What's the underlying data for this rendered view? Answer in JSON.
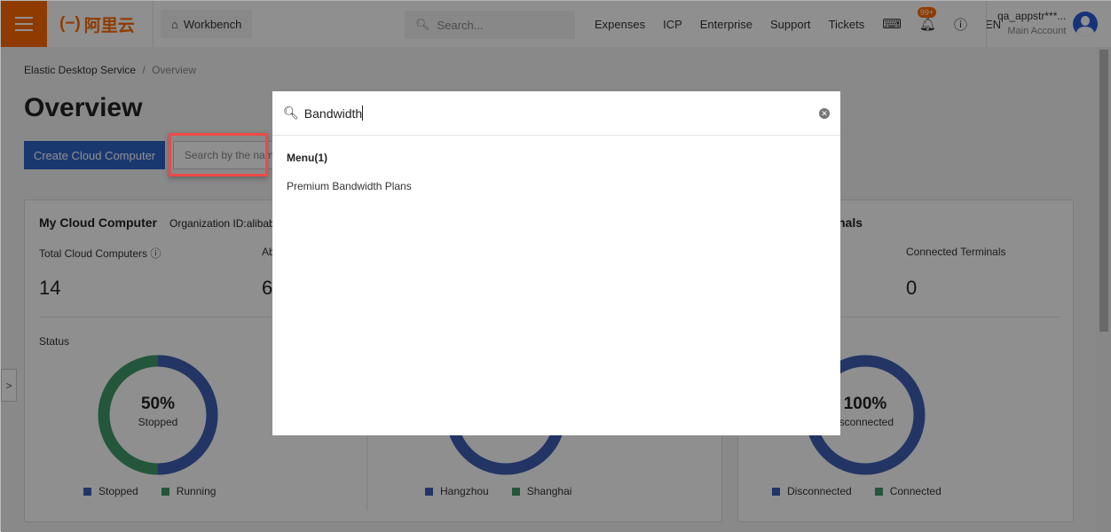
{
  "header": {
    "logo_text": "阿里云",
    "workbench": "Workbench",
    "search_placeholder": "Search...",
    "nav": [
      "Expenses",
      "ICP",
      "Enterprise",
      "Support",
      "Tickets"
    ],
    "notification_badge": "99+",
    "language": "EN",
    "account_name": "qa_appstr***...",
    "account_type": "Main Account",
    "brand_color": "#ff6a00"
  },
  "breadcrumb": {
    "parent": "Elastic Desktop Service",
    "sep": "/",
    "current": "Overview"
  },
  "page": {
    "title": "Overview",
    "create_button": "Create Cloud Computer",
    "search_placeholder": "Search by the name"
  },
  "card1": {
    "title": "My Cloud Computer",
    "org": "Organization ID:alibab",
    "total_label": "Total Cloud Computers",
    "total_value": "14",
    "second_label": "Ab",
    "second_value": "6",
    "status_label": "Status",
    "donut": {
      "percent": "50%",
      "caption": "Stopped",
      "stopped_fraction": 0.5,
      "legend": [
        "Stopped",
        "Running"
      ]
    },
    "region_donut": {
      "legend": [
        "Hangzhou",
        "Shanghai"
      ]
    }
  },
  "card2": {
    "title_partial": "nals",
    "connected_label": "Connected Terminals",
    "connected_value": "0",
    "donut": {
      "percent": "100%",
      "caption": "isconnected",
      "disconnected_fraction": 1.0,
      "legend": [
        "Disconnected",
        "Connected"
      ]
    }
  },
  "colors": {
    "blue": "#3d5fb5",
    "green": "#3f9a68"
  },
  "modal": {
    "query": "Bandwidth",
    "group": "Menu(1)",
    "results": [
      "Premium Bandwidth Plans"
    ]
  }
}
